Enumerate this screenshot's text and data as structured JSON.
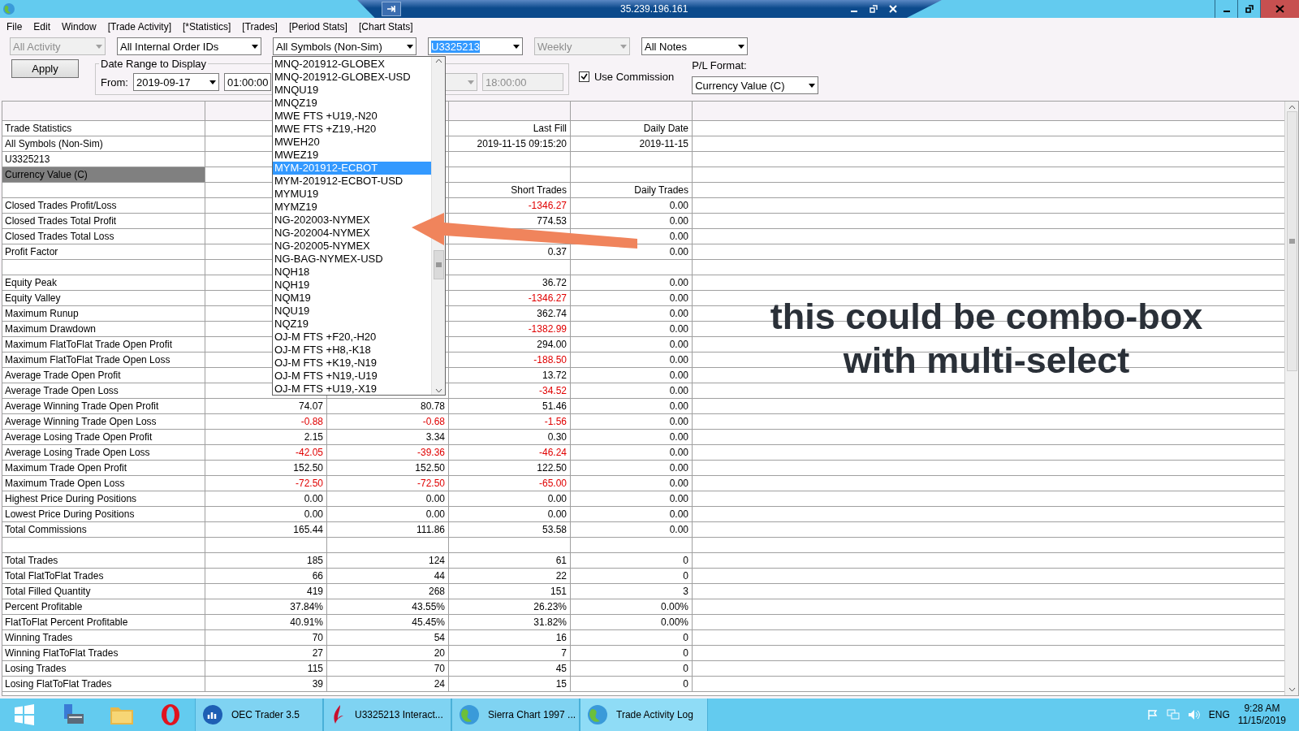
{
  "window": {
    "title": "35.239.196.161"
  },
  "menu": [
    "File",
    "Edit",
    "Window",
    "[Trade Activity]",
    "[*Statistics]",
    "[Trades]",
    "[Period Stats]",
    "[Chart Stats]"
  ],
  "filters": [
    {
      "value": "All Activity",
      "disabled": true,
      "text_selected": false
    },
    {
      "value": "All Internal Order IDs",
      "disabled": false,
      "text_selected": false
    },
    {
      "value": "All Symbols (Non-Sim)",
      "disabled": false,
      "text_selected": false
    },
    {
      "value": "U3325213",
      "disabled": false,
      "text_selected": true
    },
    {
      "value": "Weekly",
      "disabled": true,
      "text_selected": false
    },
    {
      "value": "All Notes",
      "disabled": false,
      "text_selected": false
    }
  ],
  "apply_button": "Apply",
  "date_range": {
    "title": "Date Range to Display",
    "from_label": "From:",
    "from_date": "2019-09-17",
    "from_time": "01:00:00",
    "to_time": "18:00:00",
    "to_disabled": true
  },
  "use_commission": {
    "label": "Use Commission",
    "checked": true
  },
  "pl_format": {
    "label": "P/L Format:",
    "value": "Currency Value (C)"
  },
  "symbol_list": {
    "items": [
      {
        "text": "MNQ-201912-GLOBEX",
        "selected": false
      },
      {
        "text": "MNQ-201912-GLOBEX-USD",
        "selected": false
      },
      {
        "text": "MNQU19",
        "selected": false
      },
      {
        "text": "MNQZ19",
        "selected": false
      },
      {
        "text": "MWE FTS +U19,-N20",
        "selected": false
      },
      {
        "text": "MWE FTS +Z19,-H20",
        "selected": false
      },
      {
        "text": "MWEH20",
        "selected": false
      },
      {
        "text": "MWEZ19",
        "selected": false
      },
      {
        "text": "MYM-201912-ECBOT",
        "selected": true
      },
      {
        "text": "MYM-201912-ECBOT-USD",
        "selected": false
      },
      {
        "text": "MYMU19",
        "selected": false
      },
      {
        "text": "MYMZ19",
        "selected": false
      },
      {
        "text": "NG-202003-NYMEX",
        "selected": false
      },
      {
        "text": "NG-202004-NYMEX",
        "selected": false
      },
      {
        "text": "NG-202005-NYMEX",
        "selected": false
      },
      {
        "text": "NG-BAG-NYMEX-USD",
        "selected": false
      },
      {
        "text": "NQH18",
        "selected": false
      },
      {
        "text": "NQH19",
        "selected": false
      },
      {
        "text": "NQM19",
        "selected": false
      },
      {
        "text": "NQU19",
        "selected": false
      },
      {
        "text": "NQZ19",
        "selected": false
      },
      {
        "text": "OJ-M FTS +F20,-H20",
        "selected": false
      },
      {
        "text": "OJ-M FTS +H8,-K18",
        "selected": false
      },
      {
        "text": "OJ-M FTS +K19,-N19",
        "selected": false
      },
      {
        "text": "OJ-M FTS +N19,-U19",
        "selected": false
      },
      {
        "text": "OJ-M FTS +U19,-X19",
        "selected": false
      }
    ]
  },
  "table": {
    "rows": [
      {
        "label": "Trade Statistics",
        "highlighted": false,
        "cells": [
          null,
          null,
          {
            "text": "Last Fill",
            "negative": false
          },
          {
            "text": "Daily Date",
            "negative": false
          }
        ]
      },
      {
        "label": "All Symbols (Non-Sim)",
        "highlighted": false,
        "cells": [
          null,
          null,
          {
            "text": "2019-11-15  09:15:20",
            "negative": false
          },
          {
            "text": "2019-11-15",
            "negative": false
          }
        ]
      },
      {
        "label": "U3325213",
        "highlighted": false,
        "cells": [
          null,
          null,
          null,
          null
        ]
      },
      {
        "label": "Currency Value (C)",
        "highlighted": true,
        "cells": [
          null,
          null,
          null,
          null
        ]
      },
      {
        "highlighted": false,
        "cells": [
          null,
          null,
          {
            "text": "Short Trades",
            "negative": false
          },
          {
            "text": "Daily Trades",
            "negative": false
          }
        ]
      },
      {
        "label": "Closed Trades Profit/Loss",
        "highlighted": false,
        "cells": [
          null,
          null,
          {
            "text": "-1346.27",
            "negative": true
          },
          {
            "text": "0.00",
            "negative": false
          }
        ]
      },
      {
        "label": "Closed Trades Total Profit",
        "highlighted": false,
        "cells": [
          null,
          null,
          {
            "text": "774.53",
            "negative": false
          },
          {
            "text": "0.00",
            "negative": false
          }
        ]
      },
      {
        "label": "Closed Trades Total Loss",
        "highlighted": false,
        "cells": [
          null,
          null,
          null,
          {
            "text": "0.00",
            "negative": false
          }
        ]
      },
      {
        "label": "Profit Factor",
        "highlighted": false,
        "cells": [
          null,
          null,
          {
            "text": "0.37",
            "negative": false
          },
          {
            "text": "0.00",
            "negative": false
          }
        ]
      },
      {
        "highlighted": false,
        "cells": [
          null,
          null,
          null,
          null
        ]
      },
      {
        "label": "Equity Peak",
        "highlighted": false,
        "cells": [
          null,
          null,
          {
            "text": "36.72",
            "negative": false
          },
          {
            "text": "0.00",
            "negative": false
          }
        ]
      },
      {
        "label": "Equity Valley",
        "highlighted": false,
        "cells": [
          null,
          null,
          {
            "text": "-1346.27",
            "negative": true
          },
          {
            "text": "0.00",
            "negative": false
          }
        ]
      },
      {
        "label": "Maximum Runup",
        "highlighted": false,
        "cells": [
          null,
          null,
          {
            "text": "362.74",
            "negative": false
          },
          {
            "text": "0.00",
            "negative": false
          }
        ]
      },
      {
        "label": "Maximum Drawdown",
        "highlighted": false,
        "cells": [
          null,
          null,
          {
            "text": "-1382.99",
            "negative": true
          },
          {
            "text": "0.00",
            "negative": false
          }
        ]
      },
      {
        "label": "Maximum FlatToFlat Trade Open Profit",
        "highlighted": false,
        "cells": [
          null,
          null,
          {
            "text": "294.00",
            "negative": false
          },
          {
            "text": "0.00",
            "negative": false
          }
        ]
      },
      {
        "label": "Maximum FlatToFlat Trade Open Loss",
        "highlighted": false,
        "cells": [
          null,
          null,
          {
            "text": "-188.50",
            "negative": true
          },
          {
            "text": "0.00",
            "negative": false
          }
        ]
      },
      {
        "label": "Average Trade Open Profit",
        "highlighted": false,
        "cells": [
          null,
          null,
          {
            "text": "13.72",
            "negative": false
          },
          {
            "text": "0.00",
            "negative": false
          }
        ]
      },
      {
        "label": "Average Trade Open Loss",
        "highlighted": false,
        "cells": [
          null,
          null,
          {
            "text": "-34.52",
            "negative": true
          },
          {
            "text": "0.00",
            "negative": false
          }
        ]
      },
      {
        "label": "Average Winning Trade Open Profit",
        "highlighted": false,
        "cells": [
          {
            "text": "74.07",
            "negative": false
          },
          {
            "text": "80.78",
            "negative": false
          },
          {
            "text": "51.46",
            "negative": false
          },
          {
            "text": "0.00",
            "negative": false
          }
        ]
      },
      {
        "label": "Average Winning Trade Open Loss",
        "highlighted": false,
        "cells": [
          {
            "text": "-0.88",
            "negative": true
          },
          {
            "text": "-0.68",
            "negative": true
          },
          {
            "text": "-1.56",
            "negative": true
          },
          {
            "text": "0.00",
            "negative": false
          }
        ]
      },
      {
        "label": "Average Losing Trade Open Profit",
        "highlighted": false,
        "cells": [
          {
            "text": "2.15",
            "negative": false
          },
          {
            "text": "3.34",
            "negative": false
          },
          {
            "text": "0.30",
            "negative": false
          },
          {
            "text": "0.00",
            "negative": false
          }
        ]
      },
      {
        "label": "Average Losing Trade Open Loss",
        "highlighted": false,
        "cells": [
          {
            "text": "-42.05",
            "negative": true
          },
          {
            "text": "-39.36",
            "negative": true
          },
          {
            "text": "-46.24",
            "negative": true
          },
          {
            "text": "0.00",
            "negative": false
          }
        ]
      },
      {
        "label": "Maximum Trade Open Profit",
        "highlighted": false,
        "cells": [
          {
            "text": "152.50",
            "negative": false
          },
          {
            "text": "152.50",
            "negative": false
          },
          {
            "text": "122.50",
            "negative": false
          },
          {
            "text": "0.00",
            "negative": false
          }
        ]
      },
      {
        "label": "Maximum Trade Open Loss",
        "highlighted": false,
        "cells": [
          {
            "text": "-72.50",
            "negative": true
          },
          {
            "text": "-72.50",
            "negative": true
          },
          {
            "text": "-65.00",
            "negative": true
          },
          {
            "text": "0.00",
            "negative": false
          }
        ]
      },
      {
        "label": "Highest Price During Positions",
        "highlighted": false,
        "cells": [
          {
            "text": "0.00",
            "negative": false
          },
          {
            "text": "0.00",
            "negative": false
          },
          {
            "text": "0.00",
            "negative": false
          },
          {
            "text": "0.00",
            "negative": false
          }
        ]
      },
      {
        "label": "Lowest Price During Positions",
        "highlighted": false,
        "cells": [
          {
            "text": "0.00",
            "negative": false
          },
          {
            "text": "0.00",
            "negative": false
          },
          {
            "text": "0.00",
            "negative": false
          },
          {
            "text": "0.00",
            "negative": false
          }
        ]
      },
      {
        "label": "Total Commissions",
        "highlighted": false,
        "cells": [
          {
            "text": "165.44",
            "negative": false
          },
          {
            "text": "111.86",
            "negative": false
          },
          {
            "text": "53.58",
            "negative": false
          },
          {
            "text": "0.00",
            "negative": false
          }
        ]
      },
      {
        "highlighted": false,
        "cells": [
          null,
          null,
          null,
          null
        ]
      },
      {
        "label": "Total Trades",
        "highlighted": false,
        "cells": [
          {
            "text": "185",
            "negative": false
          },
          {
            "text": "124",
            "negative": false
          },
          {
            "text": "61",
            "negative": false
          },
          {
            "text": "0",
            "negative": false
          }
        ]
      },
      {
        "label": "Total FlatToFlat Trades",
        "highlighted": false,
        "cells": [
          {
            "text": "66",
            "negative": false
          },
          {
            "text": "44",
            "negative": false
          },
          {
            "text": "22",
            "negative": false
          },
          {
            "text": "0",
            "negative": false
          }
        ]
      },
      {
        "label": "Total Filled Quantity",
        "highlighted": false,
        "cells": [
          {
            "text": "419",
            "negative": false
          },
          {
            "text": "268",
            "negative": false
          },
          {
            "text": "151",
            "negative": false
          },
          {
            "text": "3",
            "negative": false
          }
        ]
      },
      {
        "label": "Percent Profitable",
        "highlighted": false,
        "cells": [
          {
            "text": "37.84%",
            "negative": false
          },
          {
            "text": "43.55%",
            "negative": false
          },
          {
            "text": "26.23%",
            "negative": false
          },
          {
            "text": "0.00%",
            "negative": false
          }
        ]
      },
      {
        "label": "FlatToFlat Percent Profitable",
        "highlighted": false,
        "cells": [
          {
            "text": "40.91%",
            "negative": false
          },
          {
            "text": "45.45%",
            "negative": false
          },
          {
            "text": "31.82%",
            "negative": false
          },
          {
            "text": "0.00%",
            "negative": false
          }
        ]
      },
      {
        "label": "Winning Trades",
        "highlighted": false,
        "cells": [
          {
            "text": "70",
            "negative": false
          },
          {
            "text": "54",
            "negative": false
          },
          {
            "text": "16",
            "negative": false
          },
          {
            "text": "0",
            "negative": false
          }
        ]
      },
      {
        "label": "Winning FlatToFlat Trades",
        "highlighted": false,
        "cells": [
          {
            "text": "27",
            "negative": false
          },
          {
            "text": "20",
            "negative": false
          },
          {
            "text": "7",
            "negative": false
          },
          {
            "text": "0",
            "negative": false
          }
        ]
      },
      {
        "label": "Losing Trades",
        "highlighted": false,
        "cells": [
          {
            "text": "115",
            "negative": false
          },
          {
            "text": "70",
            "negative": false
          },
          {
            "text": "45",
            "negative": false
          },
          {
            "text": "0",
            "negative": false
          }
        ]
      },
      {
        "label": "Losing FlatToFlat Trades",
        "highlighted": false,
        "cells": [
          {
            "text": "39",
            "negative": false
          },
          {
            "text": "24",
            "negative": false
          },
          {
            "text": "15",
            "negative": false
          },
          {
            "text": "0",
            "negative": false
          }
        ]
      }
    ]
  },
  "annotation": {
    "text": "this could be combo-box with multi-select"
  },
  "taskbar": {
    "tasks": [
      {
        "label": "OEC Trader 3.5",
        "kind": "bars",
        "selected": false
      },
      {
        "label": "U3325213 Interact...",
        "kind": "flame",
        "selected": false
      },
      {
        "label": "Sierra Chart 1997 ...",
        "kind": "globe",
        "selected": false
      },
      {
        "label": "Trade Activity Log",
        "kind": "globe",
        "selected": true
      }
    ],
    "language": "ENG",
    "time": "9:28 AM",
    "date": "11/15/2019"
  }
}
